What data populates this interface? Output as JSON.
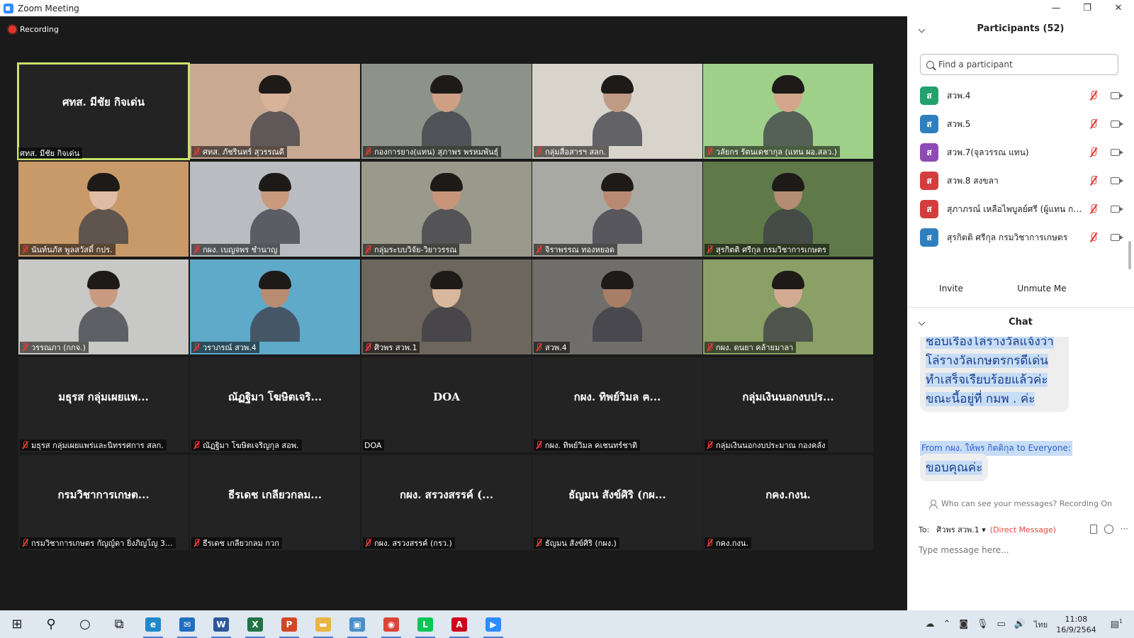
{
  "window": {
    "title": "Zoom Meeting",
    "minimize": "—",
    "restore": "❐",
    "close": "✕"
  },
  "recording_label": "Recording",
  "tiles": [
    {
      "label": "ศทส. มีชัย กิจเด่น",
      "center": "ศทส. มีชัย กิจเด่น",
      "muted": false,
      "video": false,
      "active": true
    },
    {
      "label": "ศทส. ภัชรินทร์ สุวรรณดี",
      "muted": true,
      "video": true,
      "bg": "#c9a992",
      "skin": "#d8b39a"
    },
    {
      "label": "กองการยาง(แทน) สุภาพร พรหมพันธุ์",
      "muted": true,
      "video": true,
      "bg": "#8e938a",
      "skin": "#cf9f86"
    },
    {
      "label": "กลุ่มสื่อสารฯ สลก.",
      "muted": true,
      "video": true,
      "bg": "#d8d4cb",
      "skin": "#bf9a85"
    },
    {
      "label": "วลัยกร รัตนเดชากุล (แทน ผอ.สลว.)",
      "muted": true,
      "video": true,
      "bg": "#9fd08a",
      "skin": "#d3a58b"
    },
    {
      "label": "นันท์นภัส พูลสวัสดิ์ กปร.",
      "muted": true,
      "video": true,
      "bg": "#c89a6a",
      "skin": "#e0bca4"
    },
    {
      "label": "กผง. เบญจพร ชำนาญ",
      "muted": true,
      "video": true,
      "bg": "#b9bcc0",
      "skin": "#c99a7e"
    },
    {
      "label": "กลุ่มระบบวิจัย-วิยาวรรณ",
      "muted": true,
      "video": true,
      "bg": "#9a9a8c",
      "skin": "#c8957b"
    },
    {
      "label": "จิราพรรณ ทองหยอด",
      "muted": true,
      "video": true,
      "bg": "#a9a9a4",
      "skin": "#b98a72"
    },
    {
      "label": "สุรกิตติ ศรีกุล กรมวิชาการเกษตร",
      "muted": true,
      "video": true,
      "bg": "#5f7a48",
      "skin": "#b28c73"
    },
    {
      "label": "วรรณภา (กกจ.)",
      "muted": true,
      "video": true,
      "bg": "#c8c8c6",
      "skin": "#c89a80"
    },
    {
      "label": "วราภรณ์ สวพ.4",
      "muted": true,
      "video": true,
      "bg": "#5fa9c9",
      "skin": "#b88c70"
    },
    {
      "label": "ศิวพร  สวพ.1",
      "muted": true,
      "video": true,
      "bg": "#6d665d",
      "skin": "#d9b79c"
    },
    {
      "label": "สวพ.4",
      "muted": true,
      "video": true,
      "bg": "#6f6e6a",
      "skin": "#a97e66"
    },
    {
      "label": "กผง. ดนยา คล้ายมาลา",
      "muted": true,
      "video": true,
      "bg": "#8aa066",
      "skin": "#d2ab92"
    },
    {
      "label": "มธุรส กลุ่มเผยแพร่และนิทรรศการ สลก.",
      "center": "มธุรส กลุ่มเผยแพ...",
      "muted": true,
      "video": false
    },
    {
      "label": "ณัฏฐิมา โฆษิตเจริญกุล สอพ.",
      "center": "ณัฏฐิมา โฆษิตเจริ...",
      "muted": true,
      "video": false
    },
    {
      "label": "DOA",
      "center": "DOA",
      "muted": false,
      "video": false
    },
    {
      "label": "กผง. ทิพย์วิมล คเชนทร์ชาติ",
      "center": "กผง. ทิพย์วิมล ฅ...",
      "muted": true,
      "video": false
    },
    {
      "label": "กลุ่มเงินนอกงบประมาณ กองคลัง",
      "center": "กลุ่มเงินนอกงบปร...",
      "muted": true,
      "video": false
    },
    {
      "label": "กรมวิชาการเกษตร กัญญ์ดา ยิ่งภิญโญ  3...",
      "center": "กรมวิชาการเกษต...",
      "muted": true,
      "video": false
    },
    {
      "label": "ธีรเดช เกลียวกลม กวก",
      "center": "ธีรเดช เกลียวกลม...",
      "muted": true,
      "video": false
    },
    {
      "label": "กผง. สรวงสรรค์ (กรว.)",
      "center": "กผง. สรวงสรรค์ (...",
      "muted": true,
      "video": false
    },
    {
      "label": "ธัญมน สังข์ศิริ (กผง.)",
      "center": "ธัญมน สังข์ศิริ (กผ...",
      "muted": true,
      "video": false
    },
    {
      "label": "กคง.กงน.",
      "center": "กคง.กงน.",
      "muted": true,
      "video": false
    }
  ],
  "participants": {
    "header": "Participants (52)",
    "search_placeholder": "Find a participant",
    "list": [
      {
        "avatar": "ส",
        "color": "#23a06b",
        "name": "สวพ.4"
      },
      {
        "avatar": "ส",
        "color": "#2f7fbf",
        "name": "สวพ.5"
      },
      {
        "avatar": "ส",
        "color": "#8e4ab5",
        "name": "สวพ.7(จุลวรรณ แทน)"
      },
      {
        "avatar": "ส",
        "color": "#d43d3d",
        "name": "สวพ.8 สงขลา"
      },
      {
        "avatar": "ส",
        "color": "#d43d3d",
        "name": "สุภาภรณ์ เหลือไพบูลย์ศรี (ผู้แทน กม..."
      },
      {
        "avatar": "ส",
        "color": "#2f7fbf",
        "name": "สุรกิตติ ศรีกุล กรมวิชาการเกษตร"
      }
    ],
    "invite": "Invite",
    "unmute_me": "Unmute Me"
  },
  "chat": {
    "header": "Chat",
    "message1_lines": [
      "ชอบเรื่องโล่รางวัลแจ้งว่า",
      "โล่รางวัลเกษตรกรดีเด่น",
      "ทำเสร็จเรียบร้อยแล้วค่ะ",
      "ขณะนี้อยู่ที่ กมพ . ค่ะ"
    ],
    "from_prefix": "From ",
    "from_name": "กผง. ให้พร กิตติกุล",
    "from_to": " to ",
    "from_target": "Everyone:",
    "message2": "ขอบคุณค่ะ",
    "who_can_see": "Who can see your messages? Recording On",
    "to_label": "To:",
    "to_value": "ศิวพร สวพ.1",
    "direct_message": "(Direct Message)",
    "input_placeholder": "Type message here..."
  },
  "taskbar": {
    "apps": [
      {
        "name": "windows-start",
        "glyph": "⊞",
        "color": "#1b1b1b"
      },
      {
        "name": "search",
        "glyph": "⚲",
        "color": "#1b1b1b"
      },
      {
        "name": "cortana",
        "glyph": "○",
        "color": "#1b1b1b"
      },
      {
        "name": "task-view",
        "glyph": "⧉",
        "color": "#1b1b1b"
      },
      {
        "name": "edge",
        "glyph": "e",
        "color": "#1e88c8"
      },
      {
        "name": "mail",
        "glyph": "✉",
        "color": "#1f6fc2"
      },
      {
        "name": "word",
        "glyph": "W",
        "color": "#2b579a"
      },
      {
        "name": "excel",
        "glyph": "X",
        "color": "#217346"
      },
      {
        "name": "powerpoint",
        "glyph": "P",
        "color": "#d24726"
      },
      {
        "name": "file-explorer",
        "glyph": "▬",
        "color": "#e8b645"
      },
      {
        "name": "control-panel",
        "glyph": "▣",
        "color": "#4a90c9"
      },
      {
        "name": "chrome",
        "glyph": "◉",
        "color": "#db4437"
      },
      {
        "name": "line",
        "glyph": "L",
        "color": "#06c755"
      },
      {
        "name": "acrobat",
        "glyph": "A",
        "color": "#d0021b"
      },
      {
        "name": "zoom",
        "glyph": "▶",
        "color": "#2d8cff"
      }
    ],
    "language": "ไทย",
    "time": "11:08",
    "date": "16/9/2564",
    "notification_count": "1"
  }
}
